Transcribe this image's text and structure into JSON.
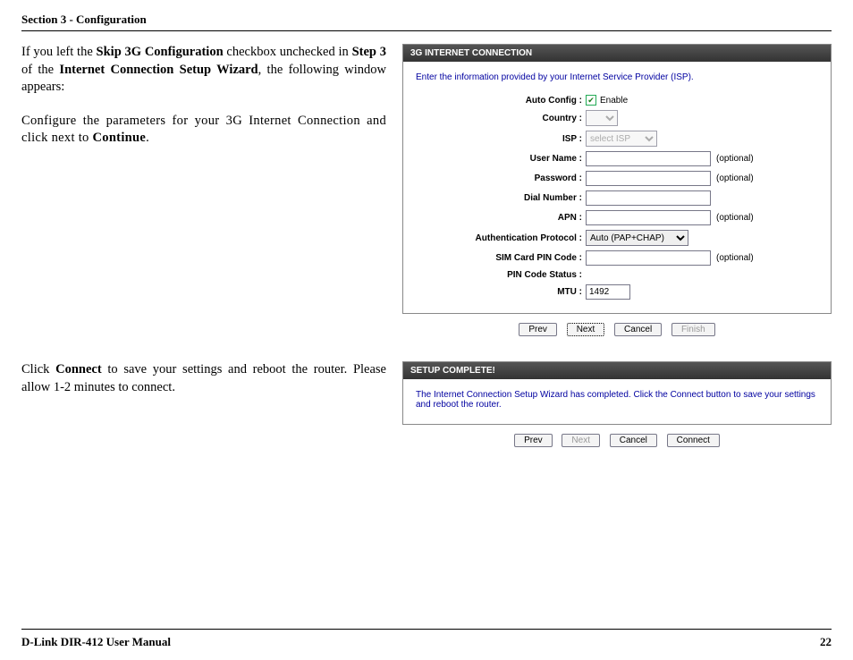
{
  "header": "Section 3 - Configuration",
  "footer_left": "D-Link DIR-412 User Manual",
  "footer_right": "22",
  "para1": {
    "t1": "If you left the ",
    "b1": "Skip 3G Configuration",
    "t2": " checkbox unchecked in ",
    "b2": "Step 3",
    "t3": " of the ",
    "b3": "Internet Connection Setup Wizard",
    "t4": ", the following window appears:"
  },
  "para2": {
    "t1": "Configure the parameters for your 3G Internet Connection and click next to ",
    "b1": "Continue",
    "t2": "."
  },
  "para3": {
    "t1": "Click ",
    "b1": "Connect",
    "t2": " to save your settings and reboot  the router. Please allow 1-2 minutes to connect."
  },
  "panel1": {
    "title": "3G INTERNET CONNECTION",
    "intro": "Enter the information provided by your Internet Service Provider (ISP).",
    "labels": {
      "auto": "Auto Config :",
      "country": "Country :",
      "isp": "ISP :",
      "user": "User Name :",
      "pass": "Password :",
      "dial": "Dial Number :",
      "apn": "APN :",
      "auth": "Authentication Protocol :",
      "pin": "SIM Card PIN Code :",
      "pinstat": "PIN Code Status :",
      "mtu": "MTU :"
    },
    "enable": "Enable",
    "optional": "(optional)",
    "isp_text": "select ISP",
    "auth_text": "Auto (PAP+CHAP)",
    "mtu_val": "1492"
  },
  "buttons1": {
    "prev": "Prev",
    "next": "Next",
    "cancel": "Cancel",
    "finish": "Finish"
  },
  "panel2": {
    "title": "SETUP COMPLETE!",
    "body": "The Internet Connection Setup Wizard has completed. Click the Connect button to save your settings and reboot the router."
  },
  "buttons2": {
    "prev": "Prev",
    "next": "Next",
    "cancel": "Cancel",
    "connect": "Connect"
  }
}
